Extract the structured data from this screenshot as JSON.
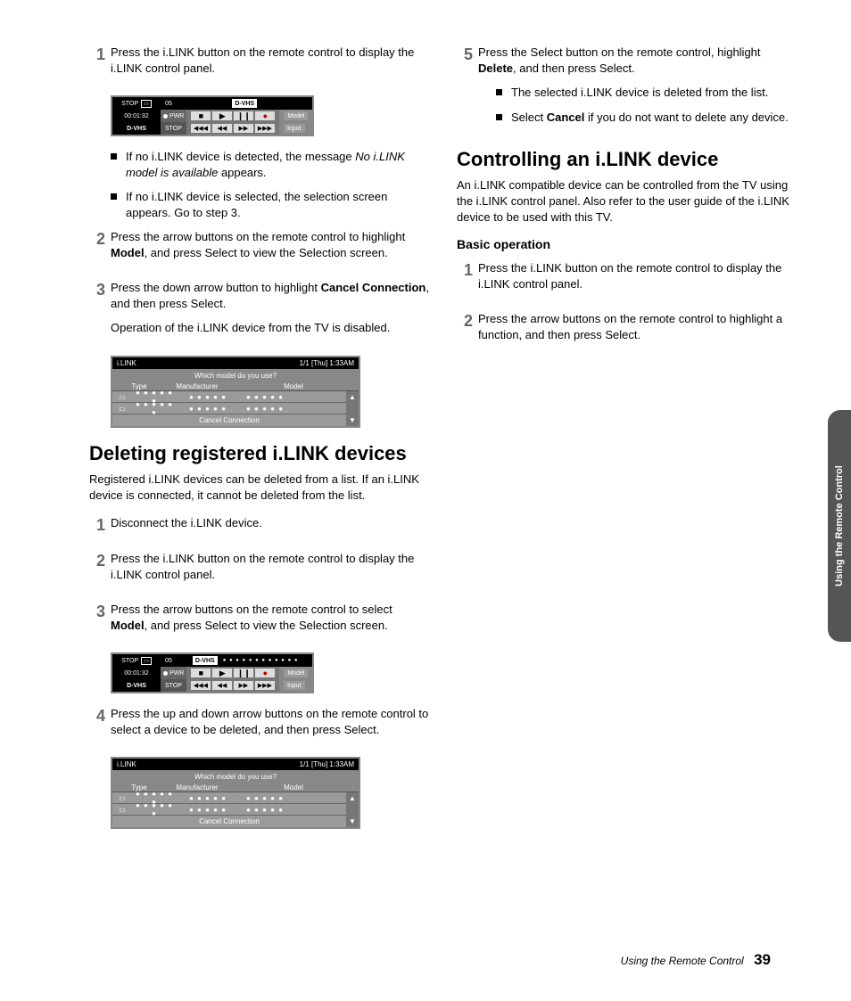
{
  "left": {
    "step1": {
      "text": "Press the i.LINK button on the remote control to display the i.LINK control panel.",
      "bullets": [
        {
          "pre": "If no i.LINK device is detected, the message ",
          "ital": "No i.LINK model is available",
          "post": " appears."
        },
        {
          "pre": "If no i.LINK device is selected, the selection screen appears. Go to step 3."
        }
      ]
    },
    "step2": {
      "pre": "Press the arrow buttons on the remote control to highlight ",
      "bold": "Model",
      "post": ", and press Select to view the Selection screen."
    },
    "step3": {
      "pre": "Press the down arrow button to highlight ",
      "bold": "Cancel Connection",
      "post": ", and then press Select.",
      "extra": "Operation of the i.LINK device from the TV is disabled."
    },
    "h2a": "Deleting registered i.LINK devices",
    "intro2": "Registered i.LINK devices can be deleted from a list. If an i.LINK device is connected, it cannot be deleted from the list.",
    "d1": "Disconnect the i.LINK device.",
    "d2": "Press the i.LINK button on the remote control to display the i.LINK control panel.",
    "d3": {
      "pre": "Press the arrow buttons on the remote control to select ",
      "bold": "Model",
      "post": ", and press Select to view the Selection screen."
    },
    "d4": "Press the up and down arrow buttons on the remote control to select a device to be deleted, and then press Select."
  },
  "right": {
    "step5": {
      "pre": "Press the Select button on the remote control, highlight ",
      "bold": "Delete",
      "post": ", and then press Select.",
      "bullets": [
        {
          "pre": "The selected i.LINK device is deleted from the list."
        },
        {
          "pre": "Select ",
          "bold": "Cancel",
          "post": " if you do not want to delete any device."
        }
      ]
    },
    "h2": "Controlling an i.LINK device",
    "intro": "An i.LINK compatible device can be controlled from the TV using the i.LINK control panel. Also refer to the user guide of the i.LINK device to be used with this TV.",
    "h3": "Basic operation",
    "b1": "Press the i.LINK button on the remote control to display the i.LINK control panel.",
    "b2": "Press the arrow buttons on the remote control to highlight a function, and then press Select."
  },
  "panel": {
    "stop_label": "STOP",
    "ch": "05",
    "dvhs": "D-VHS",
    "time": "00:01:32",
    "pwr": "PWR",
    "device": "D-VHS",
    "stop2": "STOP",
    "btn_stop": "■",
    "btn_play": "▶",
    "btn_pause": "❙❙",
    "btn_rec": "●",
    "btn_rrw": "◀◀◀",
    "btn_rw": "◀◀",
    "btn_ff": "▶▶",
    "btn_fff": "▶▶▶",
    "model": "Model",
    "input": "Input",
    "dots": "● ● ● ● ● ●  ● ● ● ● ● ●"
  },
  "sel": {
    "title": "i.LINK",
    "time": "1/1 [Thu] 1:33AM",
    "prompt": "Which model do you use?",
    "col1": "Type",
    "col2": "Manufacturer",
    "col3": "Model",
    "dots1": "● ● ● ● ● ●",
    "dots2": "● ● ● ● ●",
    "dots3": "● ● ● ● ●",
    "cancel": "Cancel Connection",
    "up": "▲",
    "dn": "▼"
  },
  "tab": "Using the Remote Control",
  "footer_sec": "Using the Remote Control",
  "footer_pg": "39"
}
